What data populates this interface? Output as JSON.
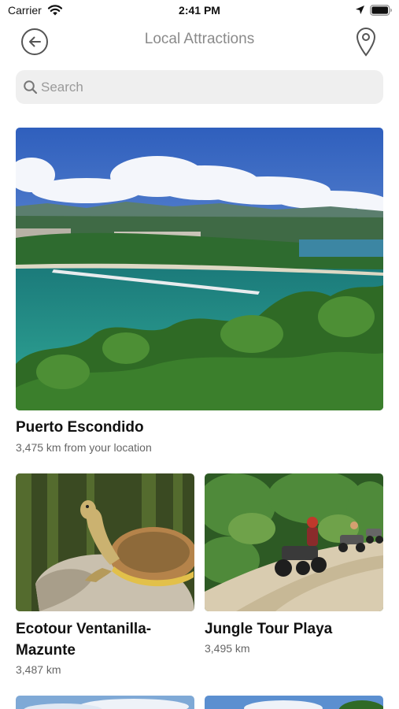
{
  "status_bar": {
    "carrier": "Carrier",
    "time": "2:41 PM",
    "icons": [
      "wifi-icon",
      "location-arrow-icon",
      "battery-icon"
    ]
  },
  "nav": {
    "title": "Local Attractions",
    "back_icon": "arrow-left-circle-icon",
    "map_icon": "map-pin-icon"
  },
  "search": {
    "placeholder": "Search",
    "value": "",
    "icon": "search-icon"
  },
  "attractions": [
    {
      "name": "Puerto Escondido",
      "distance": "3,475 km from your location",
      "image": "bay-coastline-photo"
    },
    {
      "name": "Ecotour Ventanilla-Mazunte",
      "distance": "3,487 km",
      "image": "turtle-on-rock-photo"
    },
    {
      "name": "Jungle Tour Playa",
      "distance": "3,495 km",
      "image": "atv-jungle-trail-photo"
    }
  ],
  "colors": {
    "search_bg": "#efefef",
    "title_gray": "#8a8a8a",
    "text_dark": "#111111",
    "text_muted": "#666666"
  }
}
